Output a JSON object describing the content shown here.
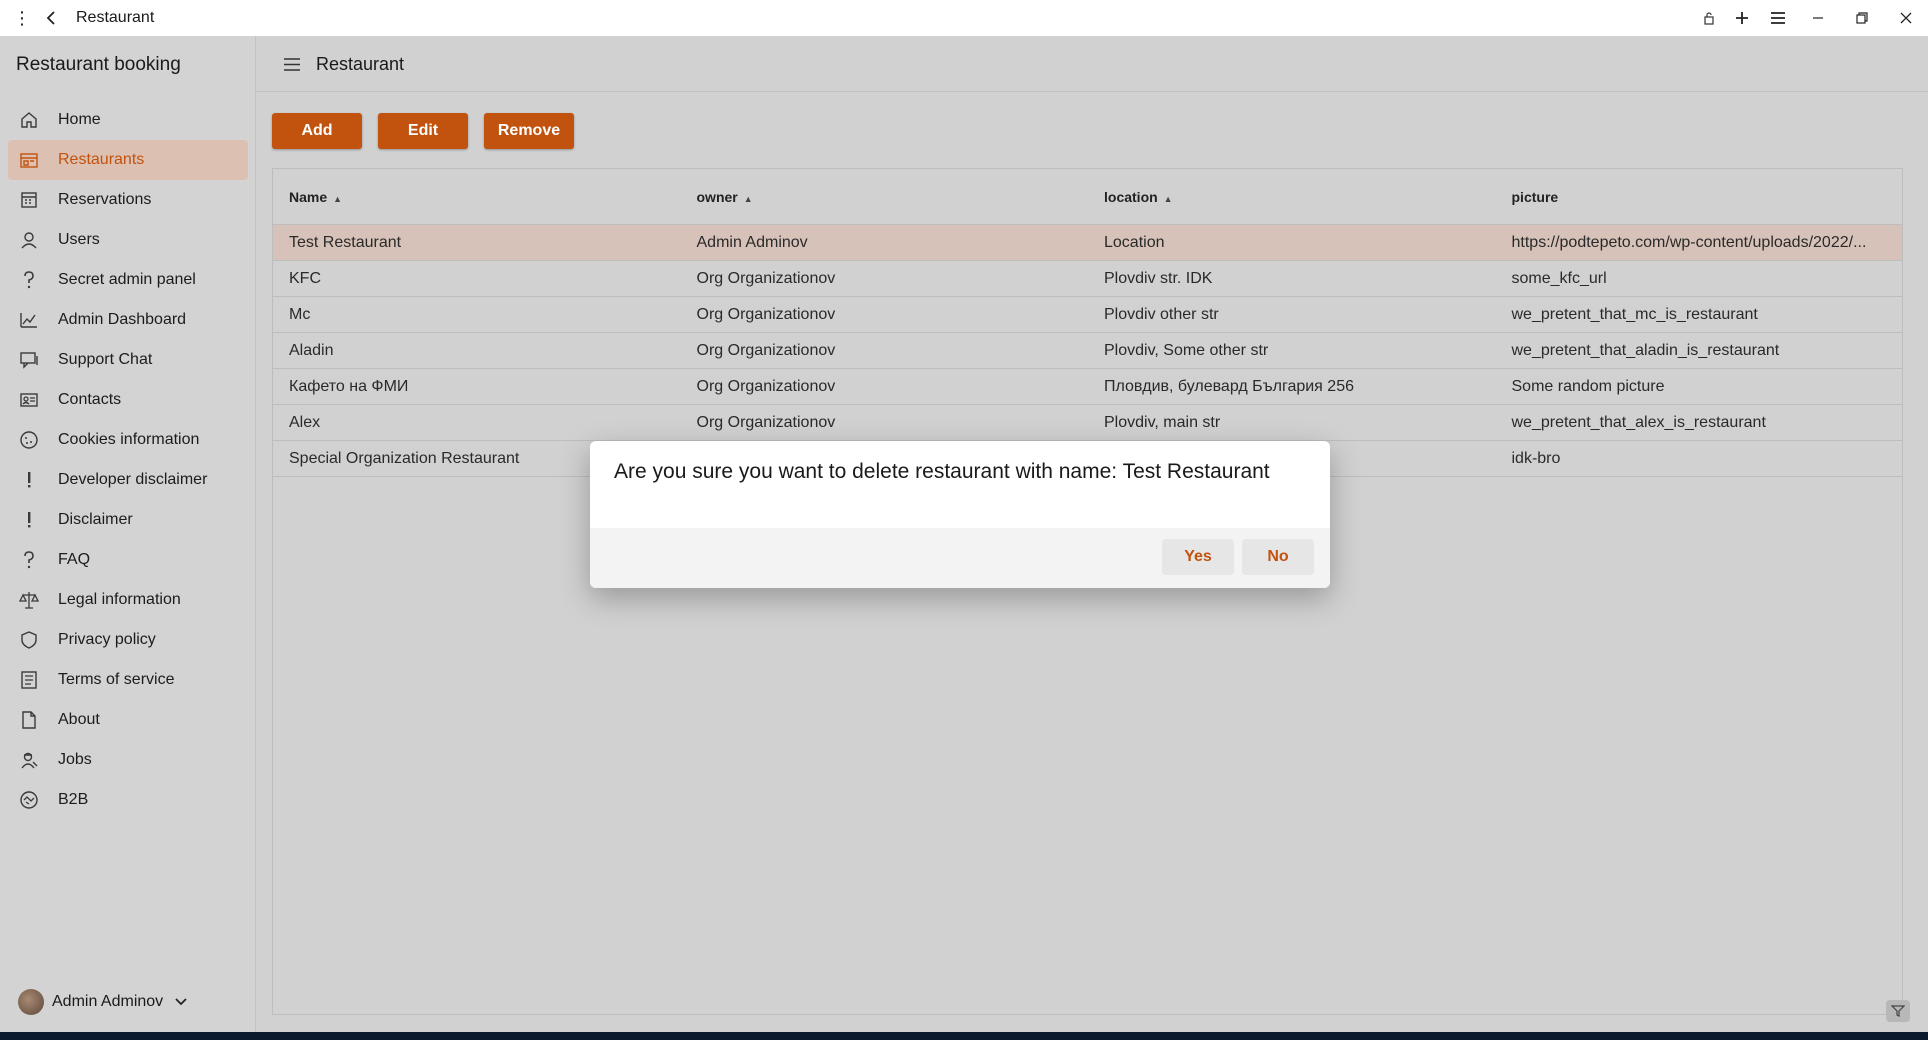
{
  "window": {
    "title": "Restaurant"
  },
  "sidebar": {
    "app_title": "Restaurant booking",
    "items": [
      {
        "label": "Home",
        "icon": "home-icon"
      },
      {
        "label": "Restaurants",
        "icon": "restaurant-icon",
        "active": true
      },
      {
        "label": "Reservations",
        "icon": "calendar-icon"
      },
      {
        "label": "Users",
        "icon": "user-icon"
      },
      {
        "label": "Secret admin panel",
        "icon": "question-icon"
      },
      {
        "label": "Admin Dashboard",
        "icon": "chart-icon"
      },
      {
        "label": "Support Chat",
        "icon": "chat-icon"
      },
      {
        "label": "Contacts",
        "icon": "contact-card-icon"
      },
      {
        "label": "Cookies information",
        "icon": "cookie-icon"
      },
      {
        "label": "Developer disclaimer",
        "icon": "exclamation-icon"
      },
      {
        "label": "Disclaimer",
        "icon": "exclamation-icon"
      },
      {
        "label": "FAQ",
        "icon": "question-icon"
      },
      {
        "label": "Legal information",
        "icon": "scales-icon"
      },
      {
        "label": "Privacy policy",
        "icon": "shield-icon"
      },
      {
        "label": "Terms of service",
        "icon": "document-icon"
      },
      {
        "label": "About",
        "icon": "page-icon"
      },
      {
        "label": "Jobs",
        "icon": "worker-icon"
      },
      {
        "label": "B2B",
        "icon": "handshake-icon"
      }
    ],
    "user_name": "Admin Adminov"
  },
  "header": {
    "title": "Restaurant"
  },
  "toolbar": {
    "add_label": "Add",
    "edit_label": "Edit",
    "remove_label": "Remove"
  },
  "table": {
    "columns": [
      "Name",
      "owner",
      "location",
      "picture"
    ],
    "rows": [
      {
        "name": "Test Restaurant",
        "owner": "Admin Adminov",
        "location": "Location",
        "picture": "https://podtepeto.com/wp-content/uploads/2022/...",
        "selected": true
      },
      {
        "name": "KFC",
        "owner": "Org Organizationov",
        "location": "Plovdiv str. IDK",
        "picture": "some_kfc_url"
      },
      {
        "name": "Mc",
        "owner": "Org Organizationov",
        "location": "Plovdiv other str",
        "picture": "we_pretent_that_mc_is_restaurant"
      },
      {
        "name": "Aladin",
        "owner": "Org Organizationov",
        "location": "Plovdiv, Some other str",
        "picture": "we_pretent_that_aladin_is_restaurant"
      },
      {
        "name": "Кафето на ФМИ",
        "owner": "Org Organizationov",
        "location": "Пловдив, булевард България 256",
        "picture": "Some random picture"
      },
      {
        "name": "Alex",
        "owner": "Org Organizationov",
        "location": "Plovdiv, main str",
        "picture": "we_pretent_that_alex_is_restaurant"
      },
      {
        "name": "Special Organization Restaurant",
        "owner": "",
        "location": "",
        "picture": "idk-bro"
      }
    ]
  },
  "dialog": {
    "message": "Are you sure you want to delete restaurant with name: Test Restaurant",
    "yes_label": "Yes",
    "no_label": "No"
  },
  "colors": {
    "accent": "#c2530e",
    "selected_row": "#d6c2b8",
    "active_nav": "#dcc0b2"
  }
}
